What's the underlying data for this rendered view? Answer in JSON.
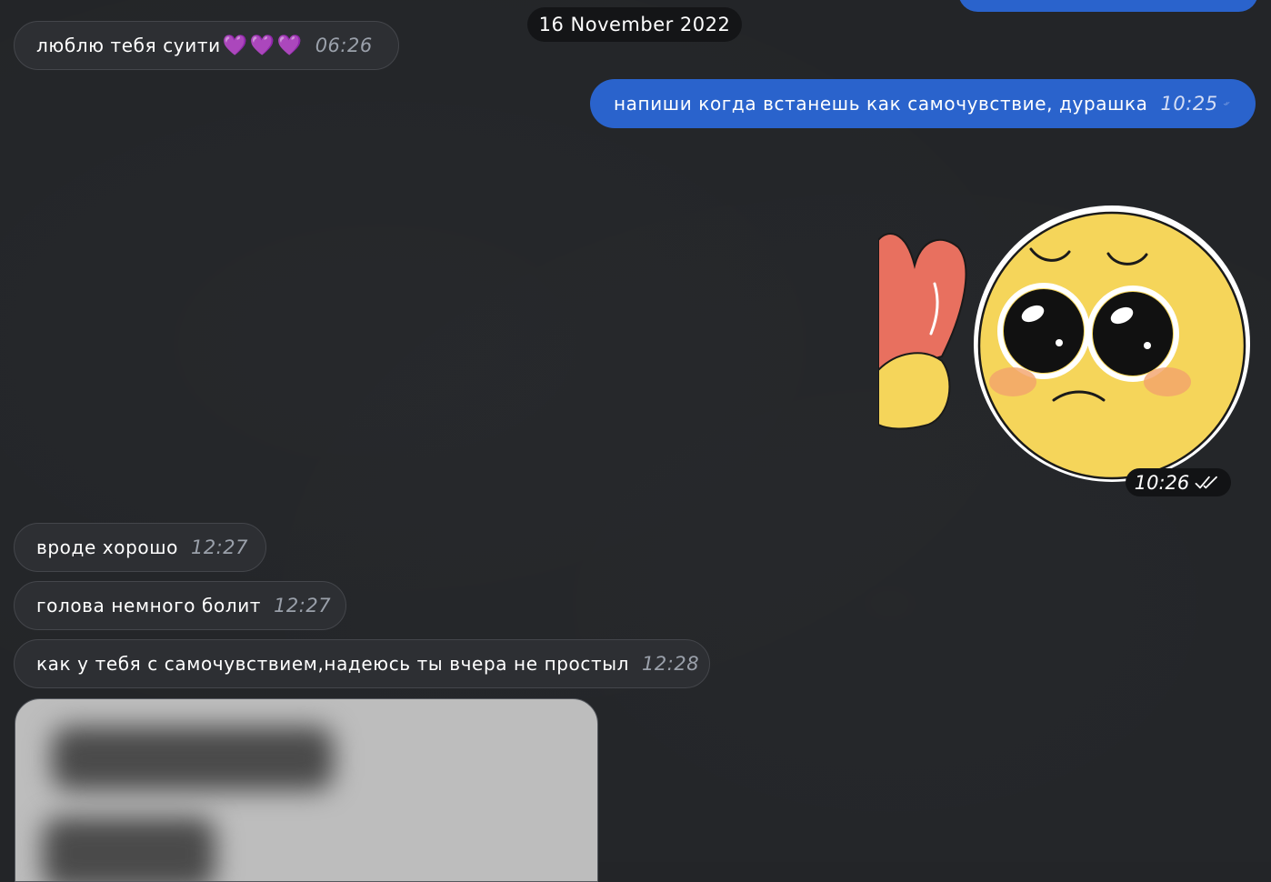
{
  "date_separator": "16 November 2022",
  "messages": [
    {
      "direction": "in",
      "text": "люблю тебя суити",
      "hearts": [
        "💜",
        "💜",
        "💜"
      ],
      "time": "06:26"
    },
    {
      "direction": "out",
      "text": "напиши когда встанешь как самочувствие, дурашка",
      "time": "10:25",
      "read": true
    },
    {
      "direction": "out",
      "type": "sticker",
      "sticker": "pleading-face-with-heart-sticker",
      "time": "10:26",
      "read": true
    },
    {
      "direction": "in",
      "text": "вроде хорошо",
      "time": "12:27"
    },
    {
      "direction": "in",
      "text": "голова немного болит",
      "time": "12:27"
    },
    {
      "direction": "in",
      "text": "как у тебя с самочувствием,надеюсь ты вчера не простыл",
      "time": "12:28"
    },
    {
      "direction": "in",
      "type": "media",
      "media": "blurred-image"
    }
  ],
  "colors": {
    "background": "#232528",
    "incoming_bubble": "#2d2f33",
    "outgoing_bubble": "#2a63cc",
    "heart": "#a35cf5"
  },
  "icons": {
    "read_receipt": "double-check-icon",
    "heart": "purple-heart-icon"
  }
}
